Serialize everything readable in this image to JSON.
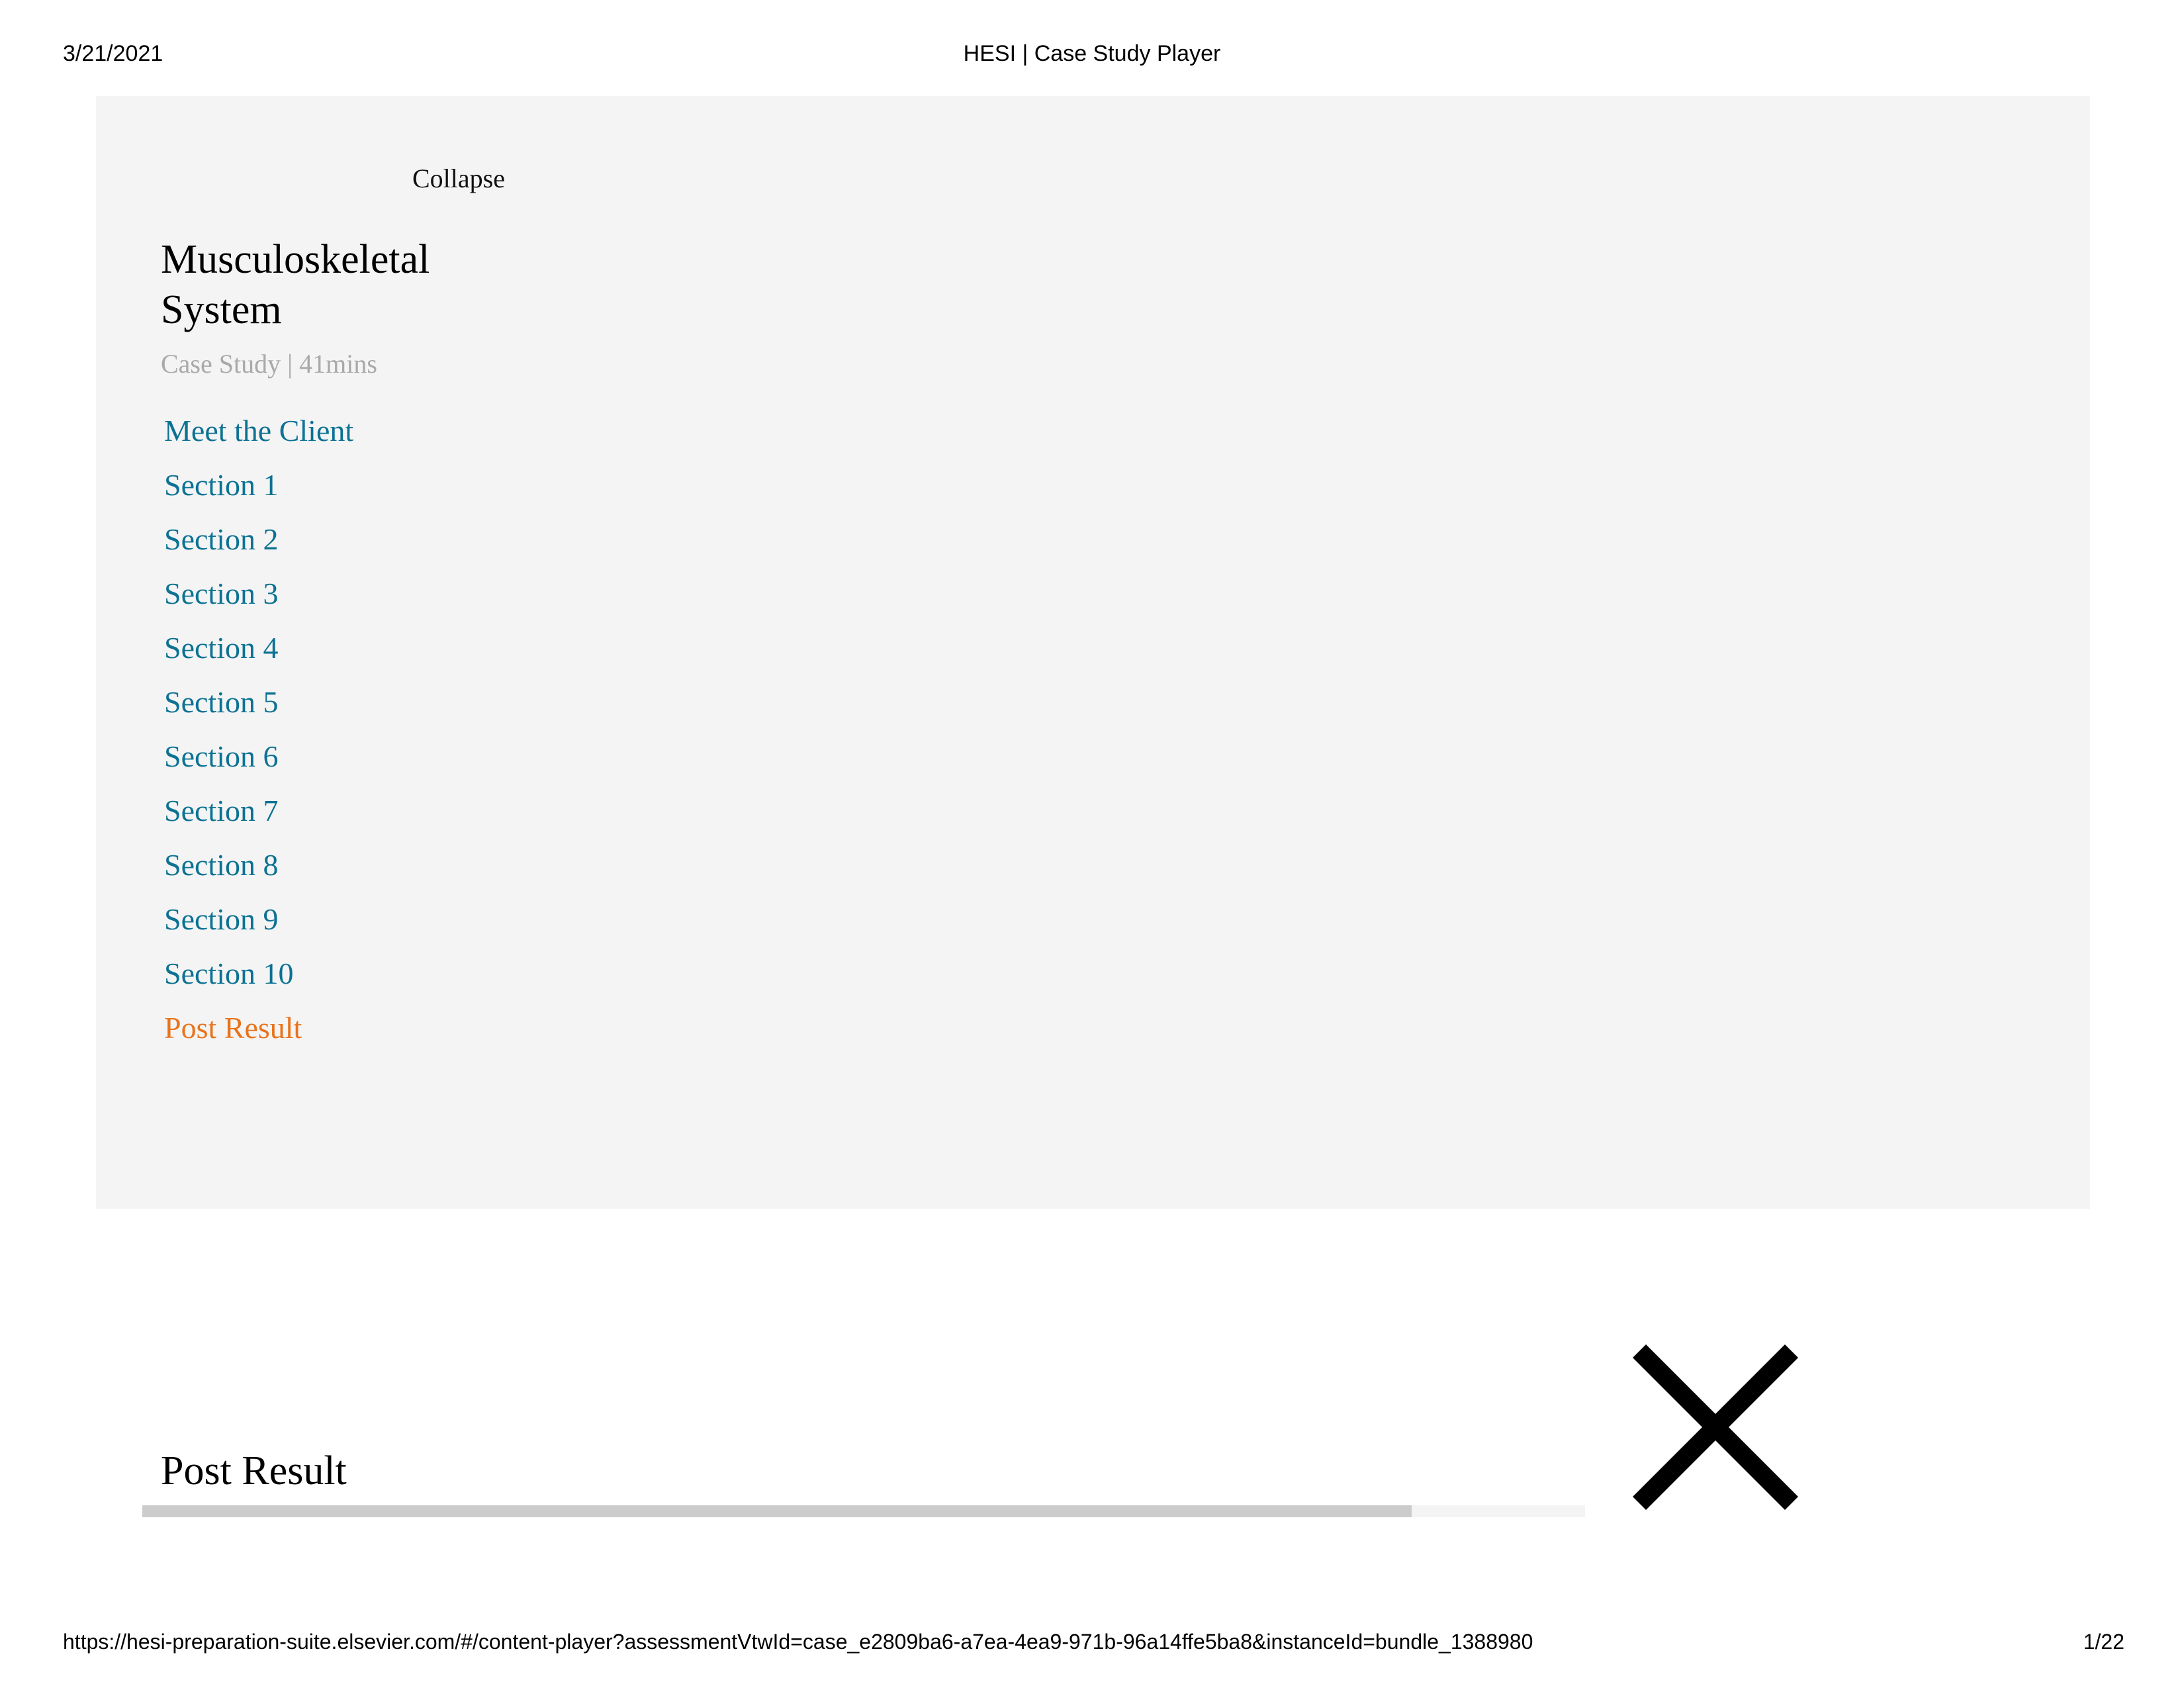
{
  "print_header": {
    "date": "3/21/2021",
    "title": "HESI | Case Study Player"
  },
  "nav_panel": {
    "collapse_label": "Collapse",
    "case_title": "Musculoskeletal System",
    "case_meta": "Case Study | 41mins",
    "sections": [
      {
        "label": "Meet the Client",
        "current": false
      },
      {
        "label": "Section 1",
        "current": false
      },
      {
        "label": "Section 2",
        "current": false
      },
      {
        "label": "Section 3",
        "current": false
      },
      {
        "label": "Section 4",
        "current": false
      },
      {
        "label": "Section 5",
        "current": false
      },
      {
        "label": "Section 6",
        "current": false
      },
      {
        "label": "Section 7",
        "current": false
      },
      {
        "label": "Section 8",
        "current": false
      },
      {
        "label": "Section 9",
        "current": false
      },
      {
        "label": "Section 10",
        "current": false
      },
      {
        "label": "Post Result",
        "current": true
      }
    ]
  },
  "content": {
    "heading": "Post Result",
    "progress_percent": 88,
    "close_icon": "close-icon"
  },
  "print_footer": {
    "url": "https://hesi-preparation-suite.elsevier.com/#/content-player?assessmentVtwId=case_e2809ba6-a7ea-4ea9-971b-96a14ffe5ba8&instanceId=bundle_1388980",
    "page": "1/22"
  },
  "colors": {
    "link": "#0c7293",
    "current_link": "#e8731c",
    "panel_bg": "#f4f4f4",
    "meta_text": "#a9a9a9",
    "progress_fill": "#cccccc"
  }
}
